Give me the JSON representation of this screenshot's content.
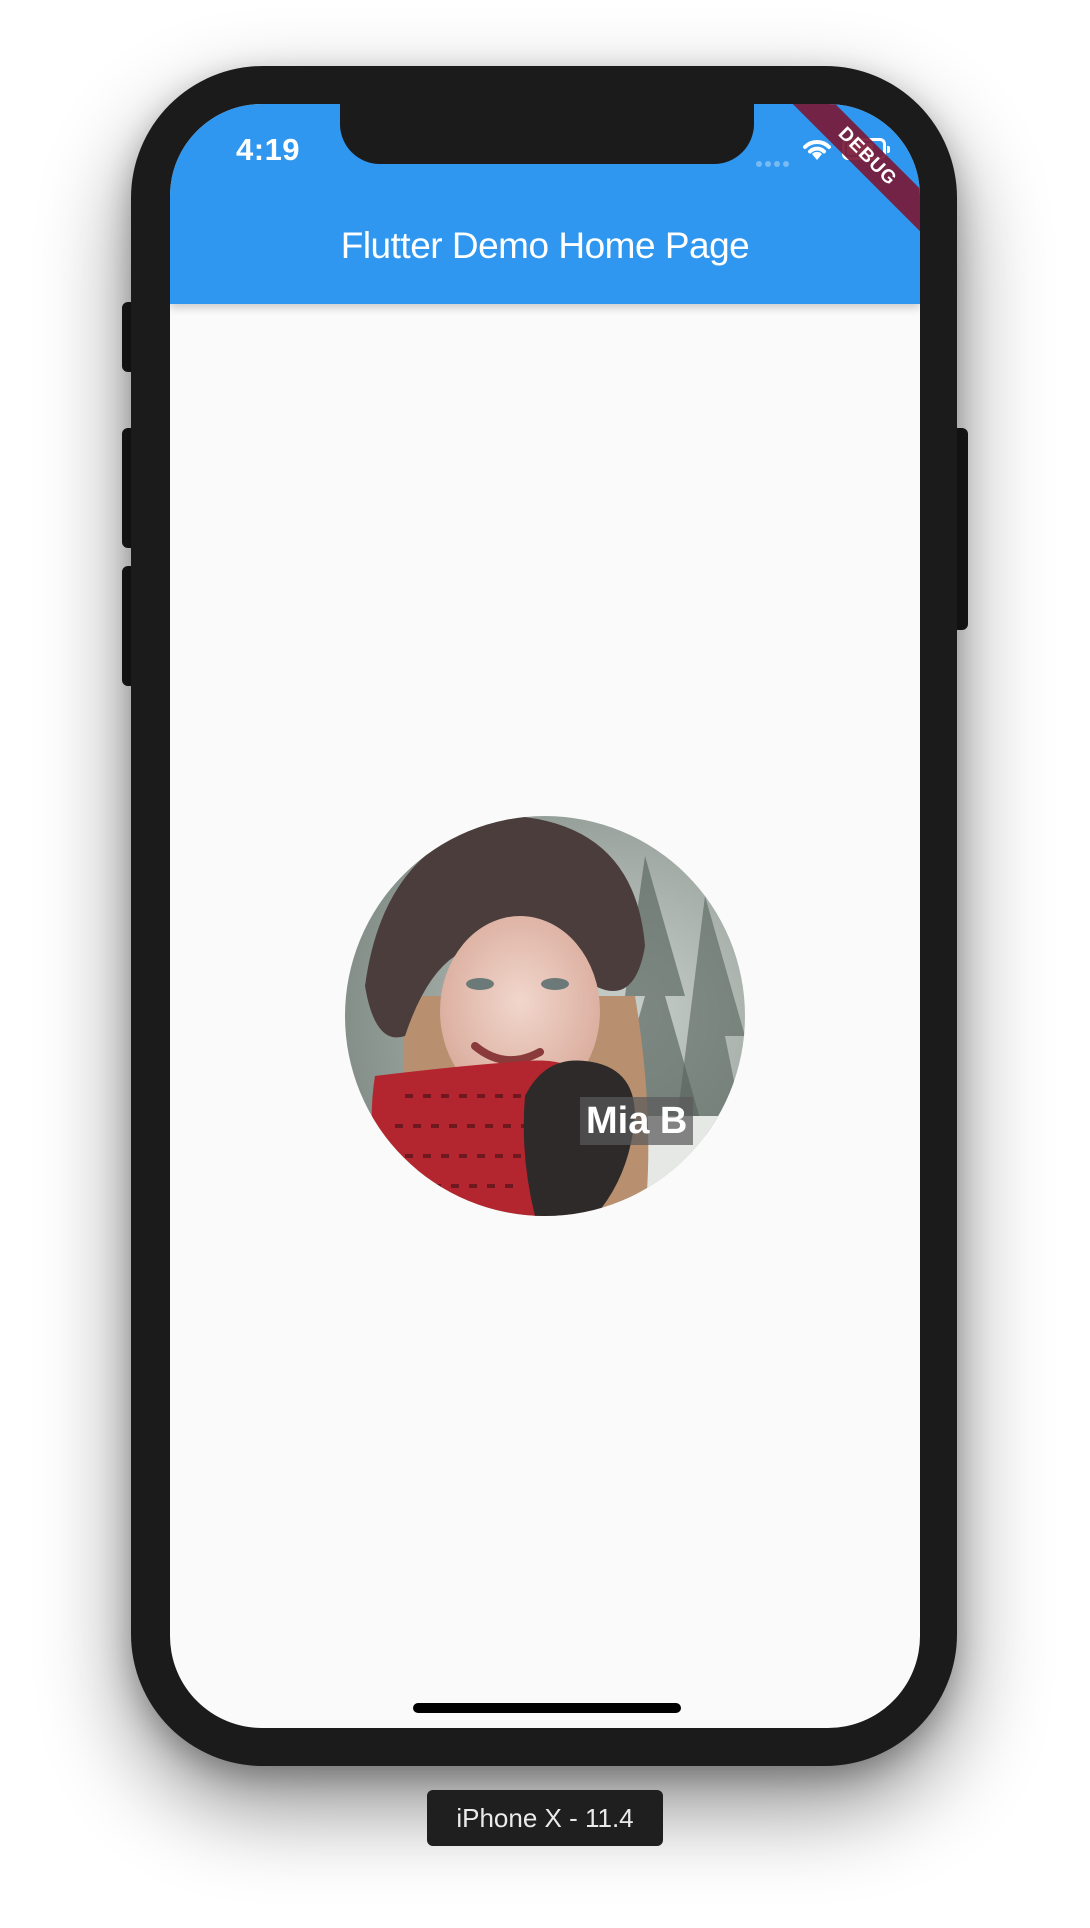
{
  "status_bar": {
    "time": "4:19",
    "icons": [
      "cellular-signal-icon",
      "wifi-icon",
      "battery-icon"
    ]
  },
  "app_bar": {
    "title": "Flutter Demo Home Page",
    "color": "#2f97ef"
  },
  "debug_banner": {
    "label": "DEBUG",
    "color": "#781937"
  },
  "profile": {
    "caption": "Mia B"
  },
  "simulator": {
    "device_label": "iPhone X - 11.4"
  },
  "colors": {
    "screen_background": "#fafafa",
    "device_frame": "#1b1b1c"
  }
}
